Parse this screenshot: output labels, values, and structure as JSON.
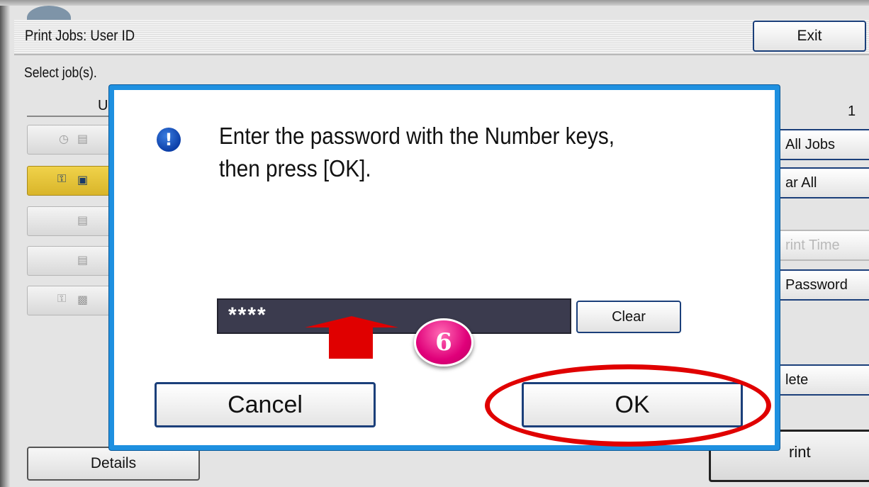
{
  "background": {
    "title": "Print Jobs: User ID",
    "exit_label": "Exit",
    "select_label": "Select job(s).",
    "column_letter": "U",
    "page_number": "1",
    "side_buttons": {
      "all_jobs": "All Jobs",
      "clear_all": "ar All",
      "print_time": "rint Time",
      "password": "Password",
      "delete": "lete"
    },
    "print_label": "rint",
    "details_label": "Details"
  },
  "dialog": {
    "message_line1": "Enter the password with the Number keys,",
    "message_line2": "then press [OK].",
    "icon_glyph": "!",
    "password_value": "****",
    "clear_label": "Clear",
    "cancel_label": "Cancel",
    "ok_label": "OK"
  },
  "annotations": {
    "step_number": "6",
    "arrow_color": "#e00000",
    "ring_color": "#e00000",
    "badge_color": "#e0007a"
  },
  "colors": {
    "dialog_border": "#1e90e0",
    "button_border": "#1b3f7a",
    "selected_row": "#f0d24a"
  }
}
